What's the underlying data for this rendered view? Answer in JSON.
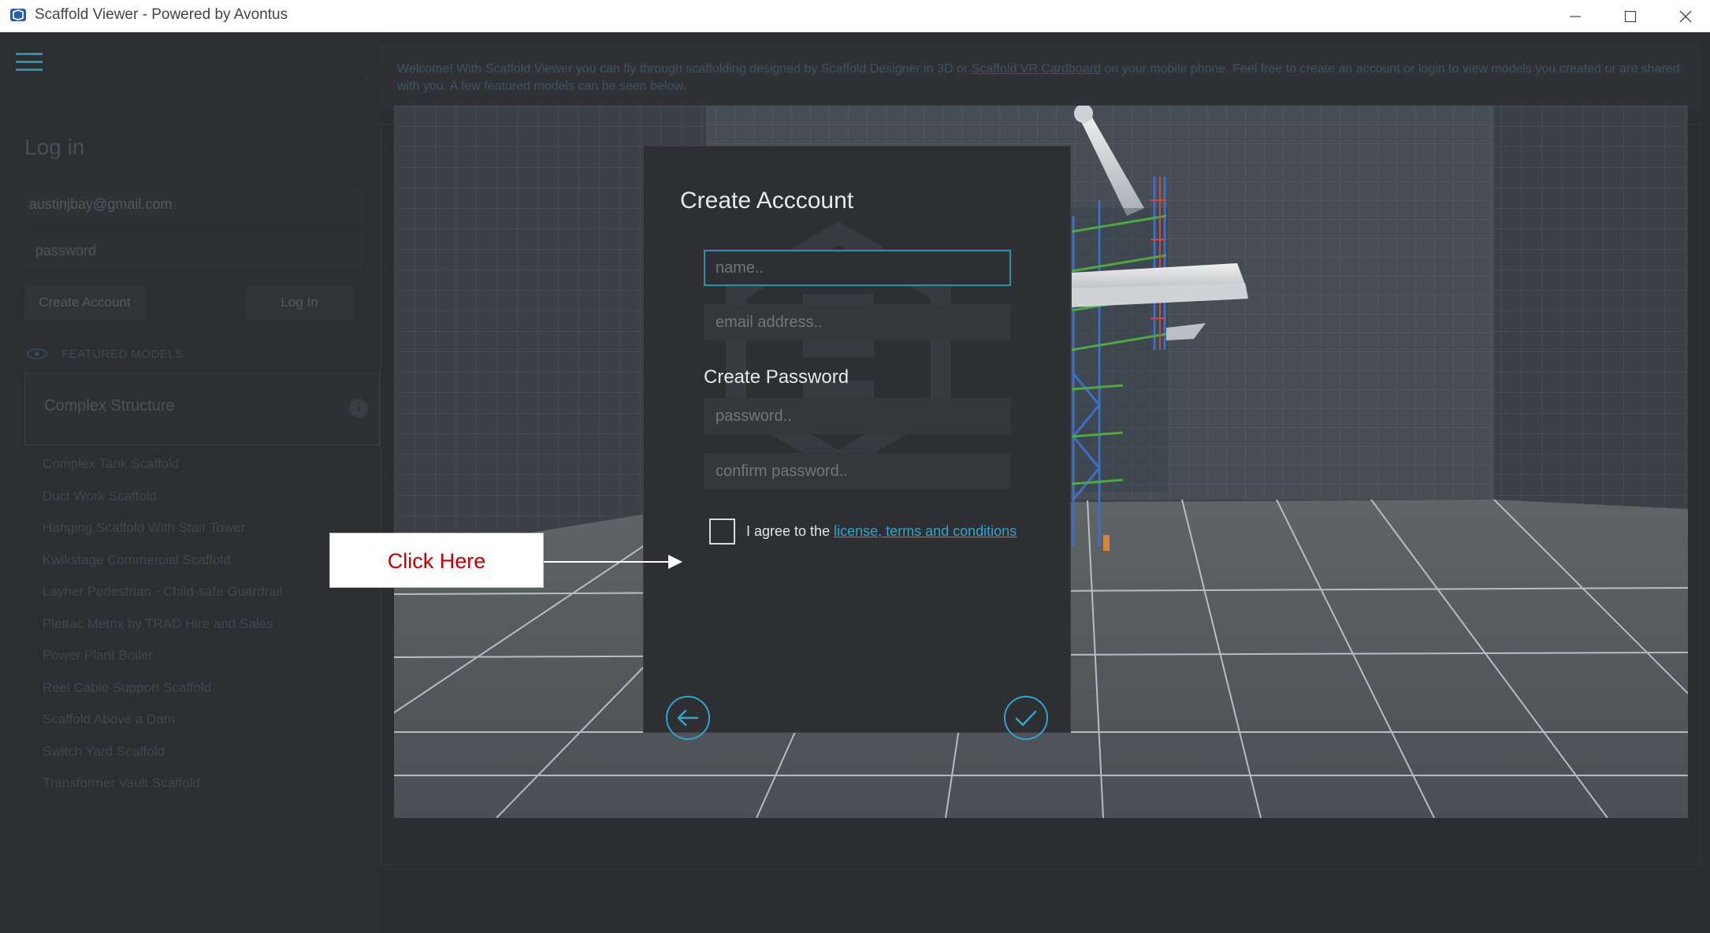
{
  "window": {
    "title": "Scaffold Viewer - Powered by Avontus"
  },
  "sidebar": {
    "login_title": "Log in",
    "email_value": "austinjbay@gmail.com",
    "password_placeholder": "password",
    "create_account_label": "Create Account",
    "login_label": "Log In",
    "featured_header": "FEATURED MODELS",
    "featured_card_title": "Complex Structure",
    "models": [
      "Complex Tank Scaffold",
      "Duct Work Scaffold",
      "Hanging Scaffold With Stair Tower",
      "Kwikstage Commercial Scaffold",
      "Layher Pedestrian - Child-safe Guardrail",
      "Plettac Metrix by TRAD Hire and Sales",
      "Power Plant Boiler",
      "Reel Cable Support Scaffold",
      "Scaffold Above a Dam",
      "Switch Yard Scaffold",
      "Transformer Vault Scaffold"
    ]
  },
  "banner": {
    "text_before": "Welcome! With Scaffold Viewer you can fly through scaffolding designed by Scaffold Designer in 3D or ",
    "link": "Scaffold VR Cardboard",
    "text_after": " on your mobile phone. Feel free to create an account or login to view models you created or are shared with you. A few featured models can be seen below."
  },
  "dialog": {
    "title": "Create Acccount",
    "name_placeholder": "name..",
    "email_placeholder": "email address..",
    "password_section": "Create Password",
    "password_placeholder": "password..",
    "confirm_placeholder": "confirm password..",
    "agree_text": "I agree to the ",
    "agree_link": "license, terms and conditions"
  },
  "callout": {
    "label": "Click Here"
  },
  "colors": {
    "accent": "#2e8fb0",
    "link": "#35a3cf",
    "callout_text": "#c00000"
  }
}
